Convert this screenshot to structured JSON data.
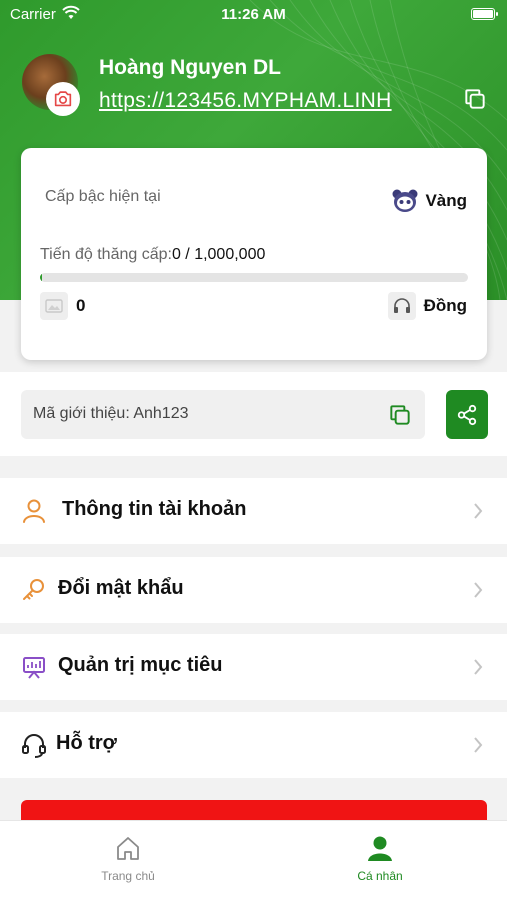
{
  "status_bar": {
    "carrier": "Carrier",
    "time": "11:26 AM"
  },
  "profile": {
    "name": "Hoàng Nguyen DL",
    "link": "https://123456.MYPHAM.LINH"
  },
  "rank_card": {
    "current_rank_label": "Cấp bậc hiện tại",
    "current_rank": "Vàng",
    "progress_label": "Tiến độ thăng cấp:",
    "progress_value": "0 / 1,000,000",
    "progress_fraction": 0.004,
    "points": "0",
    "next_rank": "Đồng"
  },
  "referral": {
    "label": "Mã giới thiệu: Anh123"
  },
  "menu": {
    "account_info": "Thông tin tài khoản",
    "change_password": "Đổi mật khẩu",
    "goal_management": "Quản trị mục tiêu",
    "support": "Hỗ trợ"
  },
  "tabbar": {
    "home": "Trang chủ",
    "profile": "Cá nhân"
  },
  "colors": {
    "brand_green": "#2f9a2c",
    "logout_red": "#f01414",
    "accent_orange": "#e8913a",
    "accent_purple": "#8a4fc7"
  },
  "icons": {
    "copy": "copy-icon",
    "share": "share-icon",
    "camera": "camera-icon",
    "user": "user-icon",
    "key": "key-icon",
    "goal": "presentation-icon",
    "support": "headset-icon",
    "home": "home-icon",
    "profile": "person-icon"
  }
}
